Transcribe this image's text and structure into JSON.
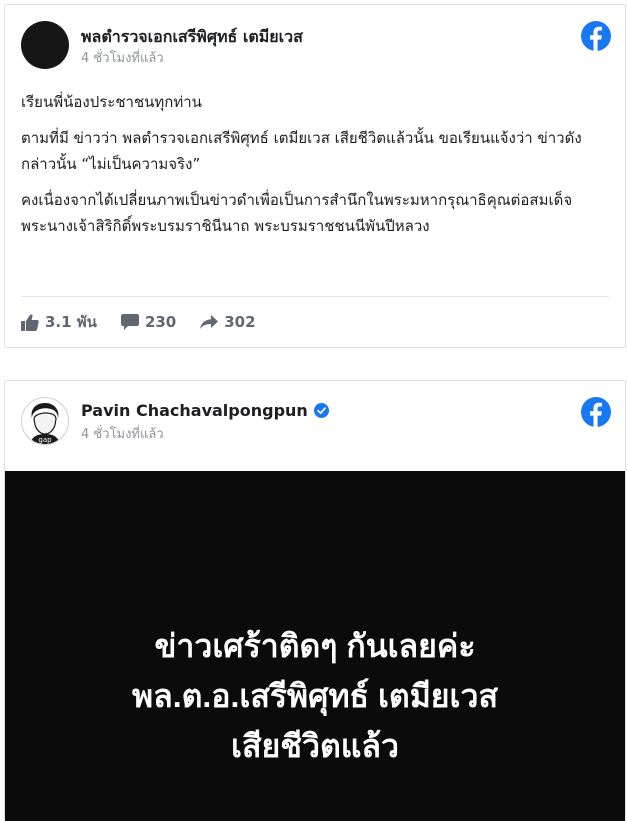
{
  "post1": {
    "author": "พลตำรวจเอกเสรีพิศุทธ์ เตมียเวส",
    "time": "4 ชั่วโมงที่แล้ว",
    "paragraphs": [
      "เรียนพี่น้องประชาชนทุกท่าน",
      "ตามที่มี ข่าวว่า พลตำรวจเอกเสรีพิศุทธ์ เตมียเวส เสียชีวิตแล้วนั้น ขอเรียนแจ้งว่า ข่าวดังกล่าวนั้น “ไม่เป็นความจริง”",
      "คงเนื่องจากได้เปลี่ยนภาพเป็นข่าวดำเพื่อเป็นการสำนึกในพระมหากรุณาธิคุณต่อสมเด็จพระนางเจ้าสิริกิติ์พระบรมราชินีนาถ พระบรมราชชนนีพันปีหลวง"
    ],
    "likes": "3.1 พัน",
    "comments": "230",
    "shares": "302",
    "icons": {
      "like": "thumbs-up-icon",
      "comment": "comment-icon",
      "share": "share-arrow-icon",
      "brand": "facebook-icon"
    }
  },
  "post2": {
    "author": "Pavin Chachavalpongpun",
    "time": "4 ชั่วโมงที่แล้ว",
    "avatar_text": "gap",
    "media_lines": [
      "ข่าวเศร้าติดๆ กันเลยค่ะ",
      "พล.ต.อ.เสรีพิศุทธ์ เตมียเวส",
      "เสียชีวิตแล้ว"
    ],
    "icons": {
      "verified": "verified-badge-icon",
      "brand": "facebook-icon"
    }
  },
  "colors": {
    "facebook_blue": "#1877f2",
    "meta_gray": "#90949c",
    "stat_gray": "#616770",
    "media_bg": "#0b0b0b"
  }
}
